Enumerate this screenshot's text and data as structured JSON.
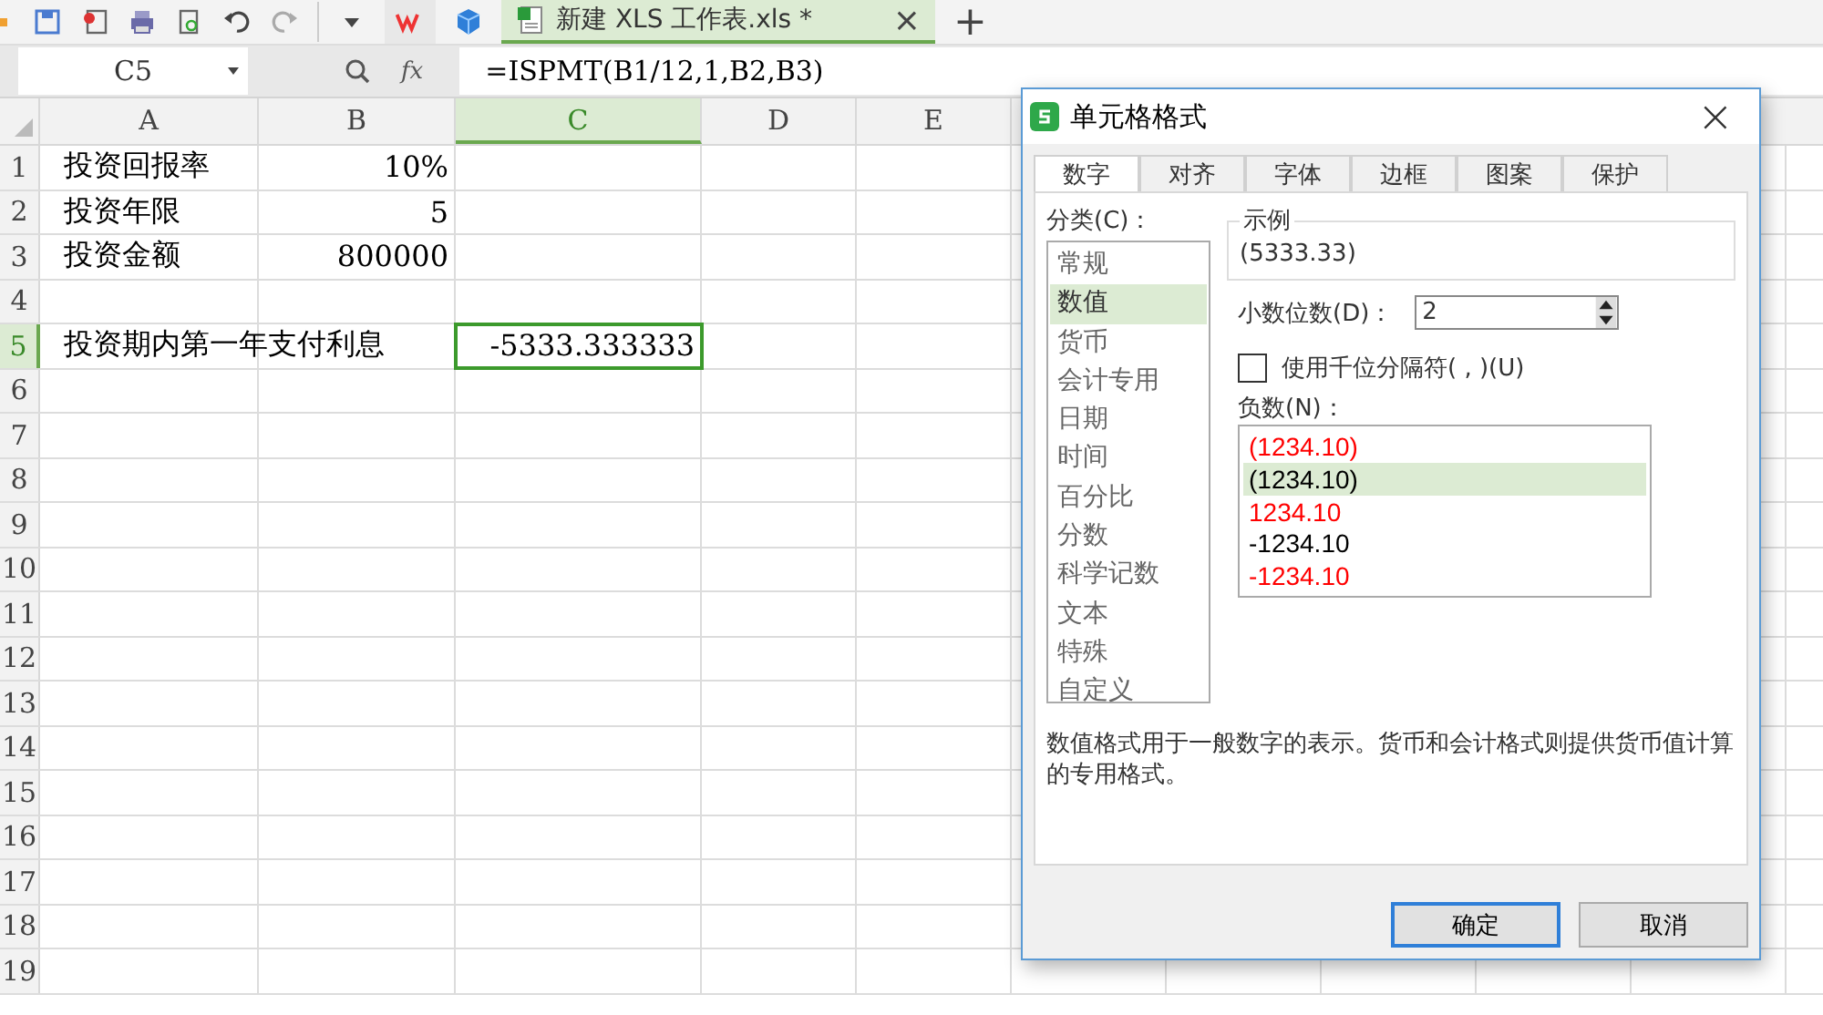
{
  "document_tab": {
    "title": "新建 XLS 工作表.xls *",
    "close": "×",
    "selected": true
  },
  "new_tab": "+",
  "formula_bar": {
    "cell_ref": "C5",
    "fx": "fx",
    "formula": "=ISPMT(B1/12,1,B2,B3)"
  },
  "columns": [
    {
      "label": "A",
      "selected": false
    },
    {
      "label": "B",
      "selected": false
    },
    {
      "label": "C",
      "selected": true
    },
    {
      "label": "D",
      "selected": false
    },
    {
      "label": "E",
      "selected": false
    }
  ],
  "rows": [
    {
      "label": "1",
      "selected": false,
      "cells": [
        "投资回报率",
        "10%",
        ""
      ]
    },
    {
      "label": "2",
      "selected": false,
      "cells": [
        "投资年限",
        "5",
        ""
      ]
    },
    {
      "label": "3",
      "selected": false,
      "cells": [
        "投资金额",
        "800000",
        ""
      ]
    },
    {
      "label": "4",
      "selected": false,
      "cells": [
        "",
        "",
        ""
      ]
    },
    {
      "label": "5",
      "selected": true,
      "cells": [
        "投资期内第一年支付利息",
        "",
        "-5333.333333"
      ]
    },
    {
      "label": "6",
      "selected": false,
      "cells": []
    },
    {
      "label": "7",
      "selected": false,
      "cells": []
    },
    {
      "label": "8",
      "selected": false,
      "cells": []
    },
    {
      "label": "9",
      "selected": false,
      "cells": []
    },
    {
      "label": "10",
      "selected": false,
      "cells": []
    },
    {
      "label": "11",
      "selected": false,
      "cells": []
    },
    {
      "label": "12",
      "selected": false,
      "cells": []
    },
    {
      "label": "13",
      "selected": false,
      "cells": []
    },
    {
      "label": "14",
      "selected": false,
      "cells": []
    },
    {
      "label": "15",
      "selected": false,
      "cells": []
    },
    {
      "label": "16",
      "selected": false,
      "cells": []
    },
    {
      "label": "17",
      "selected": false,
      "cells": []
    },
    {
      "label": "18",
      "selected": false,
      "cells": []
    },
    {
      "label": "19",
      "selected": false,
      "cells": []
    }
  ],
  "dialog": {
    "title": "单元格格式",
    "close": "×",
    "tabs": [
      {
        "label": "数字",
        "selected": true
      },
      {
        "label": "对齐",
        "selected": false
      },
      {
        "label": "字体",
        "selected": false
      },
      {
        "label": "边框",
        "selected": false
      },
      {
        "label": "图案",
        "selected": false
      },
      {
        "label": "保护",
        "selected": false
      }
    ],
    "category_label": "分类(C)：",
    "categories": [
      {
        "label": "常规",
        "selected": false
      },
      {
        "label": "数值",
        "selected": true
      },
      {
        "label": "货币",
        "selected": false
      },
      {
        "label": "会计专用",
        "selected": false
      },
      {
        "label": "日期",
        "selected": false
      },
      {
        "label": "时间",
        "selected": false
      },
      {
        "label": "百分比",
        "selected": false
      },
      {
        "label": "分数",
        "selected": false
      },
      {
        "label": "科学记数",
        "selected": false
      },
      {
        "label": "文本",
        "selected": false
      },
      {
        "label": "特殊",
        "selected": false
      },
      {
        "label": "自定义",
        "selected": false
      }
    ],
    "sample_label": "示例",
    "sample": "(5333.33)",
    "decimals_label": "小数位数(D)：",
    "decimals": "2",
    "thousands": {
      "label": "使用千位分隔符( , )(U)",
      "checked": false
    },
    "negative_label": "负数(N)：",
    "negatives": [
      {
        "label": "(1234.10)",
        "color": "#ff0000",
        "selected": false
      },
      {
        "label": "(1234.10)",
        "color": "#000000",
        "selected": true
      },
      {
        "label": "1234.10",
        "color": "#ff0000",
        "selected": false
      },
      {
        "label": "-1234.10",
        "color": "#000000",
        "selected": false
      },
      {
        "label": "-1234.10",
        "color": "#ff0000",
        "selected": false
      }
    ],
    "description": "数值格式用于一般数字的表示。货币和会计格式则提供货币值计算的专用格式。",
    "buttons": [
      {
        "label": "确定",
        "kind": "primary"
      },
      {
        "label": "取消",
        "kind": "secondary"
      }
    ]
  }
}
